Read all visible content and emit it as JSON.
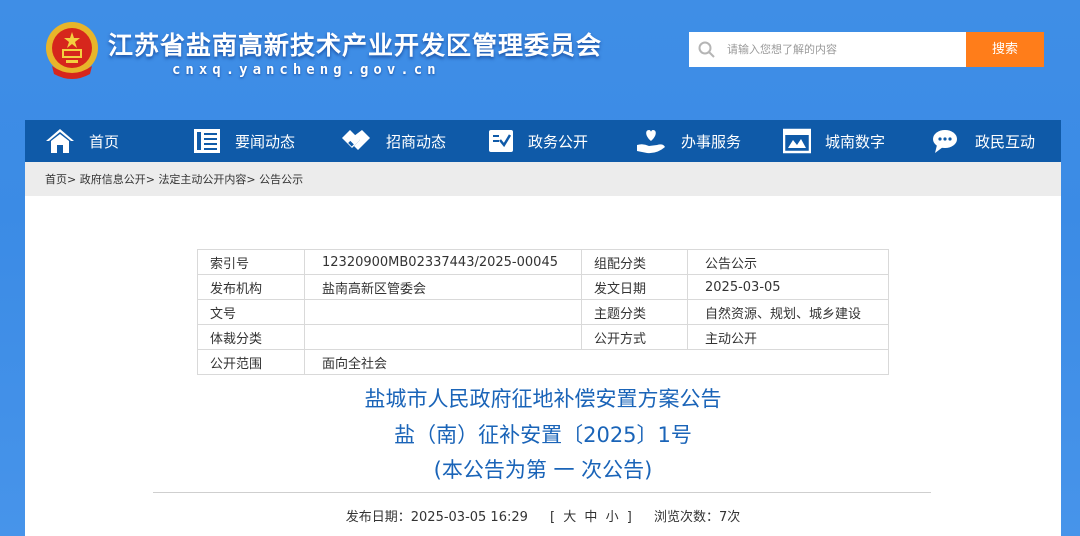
{
  "header": {
    "site_title": "江苏省盐南高新技术产业开发区管理委员会",
    "site_domain": "cnxq.yancheng.gov.cn",
    "search_placeholder": "请输入您想了解的内容",
    "search_button": "搜索"
  },
  "colors": {
    "background": "#3f8ee6",
    "nav": "#0f5aa8",
    "search_button": "#ff7d1a",
    "title_text": "#1a64b8"
  },
  "nav": {
    "items": [
      {
        "label": "首页",
        "icon": "home-icon"
      },
      {
        "label": "要闻动态",
        "icon": "news-icon"
      },
      {
        "label": "招商动态",
        "icon": "handshake-icon"
      },
      {
        "label": "政务公开",
        "icon": "document-check-icon"
      },
      {
        "label": "办事服务",
        "icon": "service-heart-icon"
      },
      {
        "label": "城南数字",
        "icon": "digital-city-icon"
      },
      {
        "label": "政民互动",
        "icon": "chat-icon"
      }
    ]
  },
  "breadcrumb": [
    "首页>",
    "政府信息公开>",
    "法定主动公开内容>",
    "公告公示"
  ],
  "meta": {
    "index_label": "索引号",
    "index_value": "12320900MB02337443/2025-00045",
    "group_label": "组配分类",
    "group_value": "公告公示",
    "org_label": "发布机构",
    "org_value": "盐南高新区管委会",
    "date_label": "发文日期",
    "date_value": "2025-03-05",
    "docno_label": "文号",
    "docno_value": "",
    "topic_label": "主题分类",
    "topic_value": "自然资源、规划、城乡建设",
    "genre_label": "体裁分类",
    "genre_value": "",
    "mode_label": "公开方式",
    "mode_value": "主动公开",
    "scope_label": "公开范围",
    "scope_value": "面向全社会"
  },
  "document": {
    "title_line1": "盐城市人民政府征地补偿安置方案公告",
    "title_line2": "盐（南）征补安置〔2025〕1号",
    "title_line3": "(本公告为第 一 次公告)"
  },
  "publish": {
    "date_text": "发布日期：2025-03-05 16:29",
    "font_open": "[",
    "font_large": "大",
    "font_medium": "中",
    "font_small": "小",
    "font_close": "]",
    "views_text": "浏览次数：7次"
  }
}
